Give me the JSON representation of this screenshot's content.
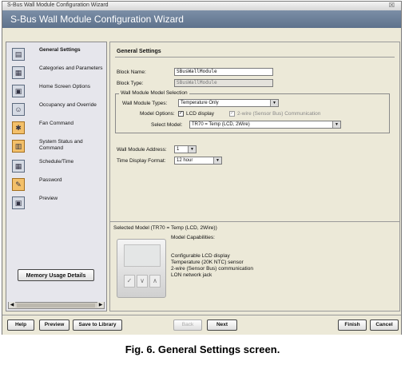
{
  "window": {
    "title": "S-Bus Wall Module Configuration Wizard",
    "header": "S-Bus Wall Module Configuration Wizard",
    "close_glyph": "☒"
  },
  "sidebar": {
    "items": [
      {
        "label": "General Settings",
        "icon": "general-settings-icon"
      },
      {
        "label": "Categories and Parameters",
        "icon": "categories-icon"
      },
      {
        "label": "Home Screen Options",
        "icon": "home-screen-icon"
      },
      {
        "label": "Occupancy and Override",
        "icon": "occupancy-icon"
      },
      {
        "label": "Fan Command",
        "icon": "fan-icon"
      },
      {
        "label": "System Status and Command",
        "icon": "system-status-icon"
      },
      {
        "label": "Schedule/Time",
        "icon": "schedule-icon"
      },
      {
        "label": "Password",
        "icon": "password-icon"
      },
      {
        "label": "Preview",
        "icon": "preview-icon"
      }
    ],
    "memory_button": "Memory Usage Details",
    "scroll_label": "…"
  },
  "main": {
    "section_title": "General Settings",
    "block_name_label": "Block Name:",
    "block_name_value": "SBusWallModule",
    "block_type_label": "Block Type:",
    "block_type_value": "SBusWallModule",
    "group_title": "Wall Module Model Selection",
    "types_label": "Wall Module Types:",
    "types_value": "Temperature Only",
    "options_label": "Model Options:",
    "opt_lcd": "LCD display",
    "opt_2wire": "2-wire (Sensor Bus) Communication",
    "select_model_label": "Select Model:",
    "select_model_value": "TR70 = Temp (LCD, 2Wire)",
    "address_label": "Wall Module Address:",
    "address_value": "1",
    "time_format_label": "Time Display Format:",
    "time_format_value": "12 hour",
    "selected_model": "Selected Model (TR70 = Temp (LCD, 2Wire))",
    "capabilities_title": "Model Capabilities:",
    "capabilities": [
      "Configurable LCD display",
      "Temperature (20K NTC) sensor",
      "2-wire (Sensor Bus) communication",
      "LON network jack"
    ]
  },
  "buttons": {
    "help": "Help",
    "preview": "Preview",
    "save": "Save to Library",
    "back": "Back",
    "next": "Next",
    "finish": "Finish",
    "cancel": "Cancel"
  },
  "caption": "Fig. 6. General Settings screen."
}
